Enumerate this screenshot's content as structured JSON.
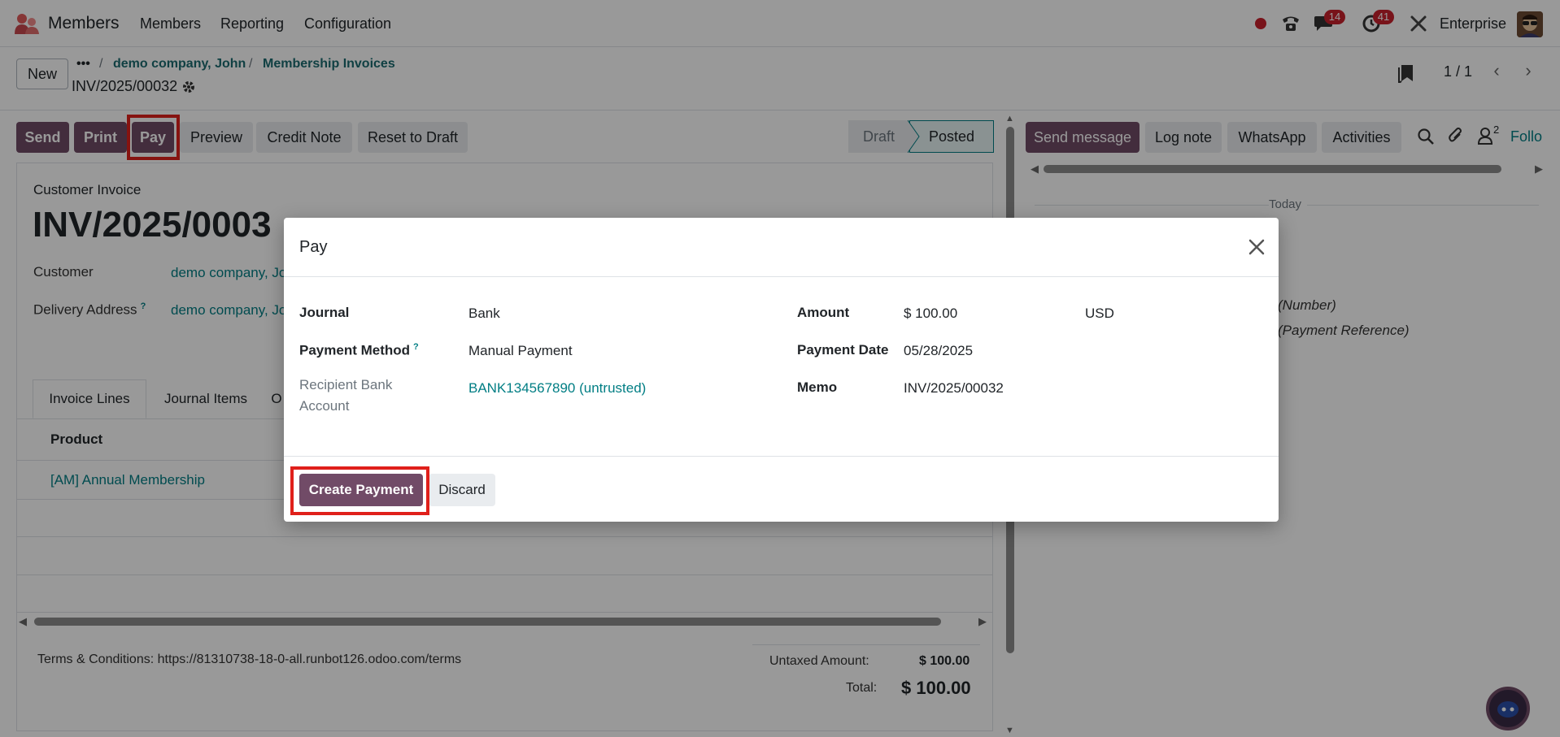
{
  "navbar": {
    "app_name": "Members",
    "menus": [
      "Members",
      "Reporting",
      "Configuration"
    ],
    "messages_count": "14",
    "activities_count": "41",
    "company": "Enterprise"
  },
  "control_panel": {
    "new_label": "New",
    "breadcrumb_more": "•••",
    "breadcrumbs": [
      "demo company, John",
      "Membership Invoices"
    ],
    "record_name": "INV/2025/00032",
    "pager": "1 / 1"
  },
  "statusbar": {
    "buttons": [
      "Send",
      "Print",
      "Pay",
      "Preview",
      "Credit Note",
      "Reset to Draft"
    ],
    "stages": [
      "Draft",
      "Posted"
    ],
    "current_stage": "Posted"
  },
  "form": {
    "type_label": "Customer Invoice",
    "invoice_number": "INV/2025/0003",
    "customer_label": "Customer",
    "customer_value": "demo company, Jo",
    "delivery_label": "Delivery Address",
    "delivery_help": "?",
    "delivery_value": "demo company, Jo",
    "tabs": [
      "Invoice Lines",
      "Journal Items",
      "O"
    ],
    "product_header": "Product",
    "line_product": "[AM] Annual Membership",
    "terms": "Terms & Conditions: https://81310738-18-0-all.runbot126.odoo.com/terms",
    "untaxed_label": "Untaxed Amount:",
    "untaxed_value": "$ 100.00",
    "total_label": "Total:",
    "total_value": "$ 100.00"
  },
  "chatter": {
    "buttons": [
      "Send message",
      "Log note",
      "WhatsApp",
      "Activities"
    ],
    "followers_count": "2",
    "follow_label": "Follo",
    "today_label": "Today",
    "log_lines": [
      "(Number)",
      "(Payment Reference)"
    ]
  },
  "dialog": {
    "title": "Pay",
    "journal_label": "Journal",
    "journal_value": "Bank",
    "payment_method_label": "Payment Method",
    "payment_method_help": "?",
    "payment_method_value": "Manual Payment",
    "recipient_label": "Recipient Bank Account",
    "recipient_value": "BANK134567890 (untrusted)",
    "amount_label": "Amount",
    "amount_value": "$ 100.00",
    "currency_value": "USD",
    "payment_date_label": "Payment Date",
    "payment_date_value": "05/28/2025",
    "memo_label": "Memo",
    "memo_value": "INV/2025/00032",
    "create_label": "Create Payment",
    "discard_label": "Discard"
  },
  "colors": {
    "primary": "#714b67",
    "link": "#017e84",
    "highlight": "#e0201b",
    "badge": "#c9202c"
  }
}
